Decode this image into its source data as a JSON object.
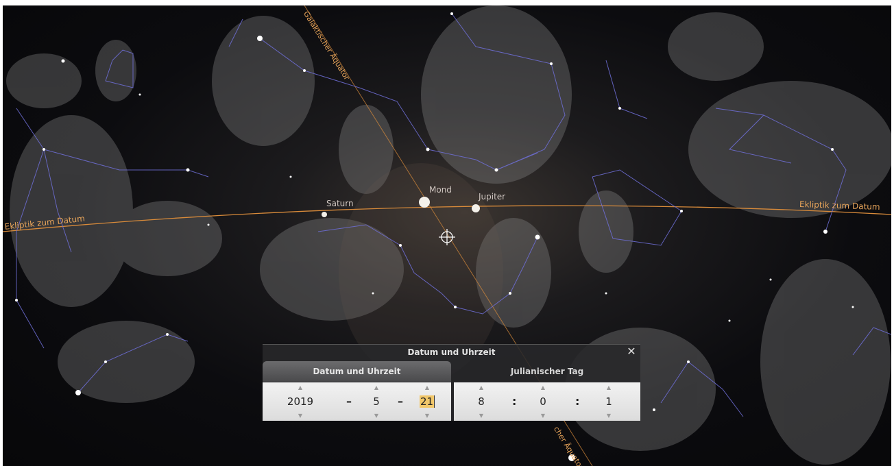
{
  "sky": {
    "labels": {
      "moon": "Mond",
      "jupiter": "Jupiter",
      "saturn": "Saturn",
      "ecliptic_left": "Ekliptik zum Datum",
      "ecliptic_right": "Ekliptik zum Datum",
      "galactic_top": "Galaktischer Äquator",
      "galactic_bottom": "cher Äquator"
    },
    "colors": {
      "ecliptic_line": "#d98b3a",
      "constellation_lines": "#6f6fd8",
      "sky_background": "#0c0c0f"
    }
  },
  "dialog": {
    "title": "Datum und Uhrzeit",
    "close_icon": "close-icon",
    "tabs": [
      {
        "label": "Datum und Uhrzeit",
        "active": true
      },
      {
        "label": "Julianischer Tag",
        "active": false
      }
    ],
    "date": {
      "year": "2019",
      "month": "5",
      "day": "21",
      "separator": "–"
    },
    "time": {
      "hour": "8",
      "minute": "0",
      "second": "1",
      "separator": ":"
    },
    "spin_up_icon": "▲",
    "spin_down_icon": "▼"
  }
}
